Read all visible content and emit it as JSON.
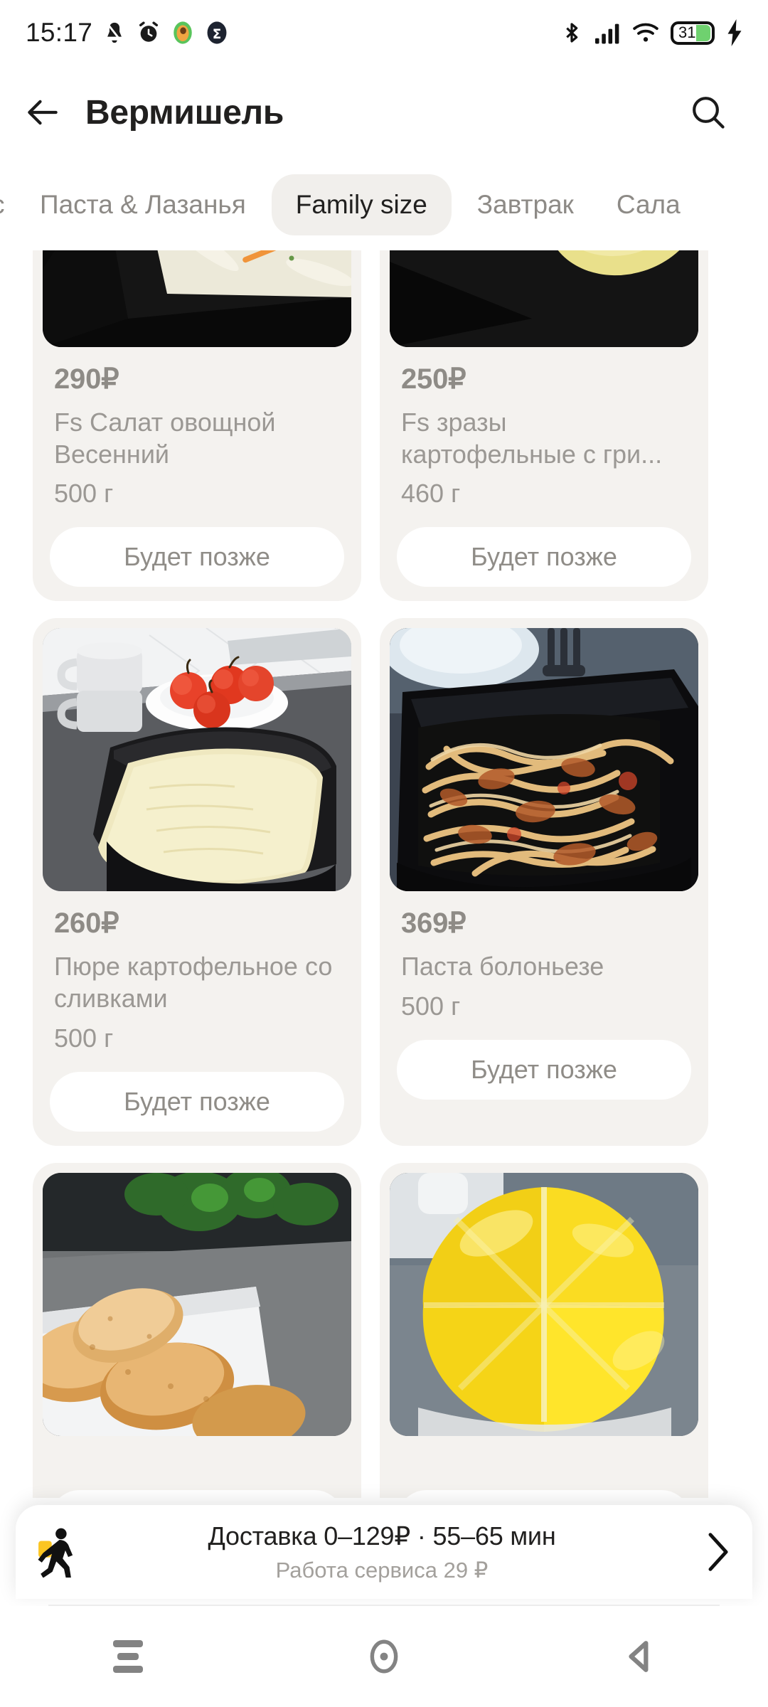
{
  "status_bar": {
    "time": "15:17",
    "left_icons": [
      "notification-silenced-icon",
      "alarm-icon",
      "avocado-app-icon",
      "sigma-app-icon"
    ],
    "right_icons": [
      "bluetooth-icon",
      "cellular-signal-icon",
      "wifi-icon",
      "battery-icon",
      "charging-bolt-icon"
    ],
    "battery_level": "31"
  },
  "header": {
    "title": "Вермишель",
    "back_icon": "back-arrow-icon",
    "search_icon": "search-icon"
  },
  "tabs": {
    "items": [
      {
        "label": "с",
        "active": false,
        "clipped": true
      },
      {
        "label": "Паста & Лазанья",
        "active": false
      },
      {
        "label": "Family size",
        "active": true
      },
      {
        "label": "Завтрак",
        "active": false
      },
      {
        "label": "Салa",
        "active": false,
        "clipped": true
      }
    ]
  },
  "products": [
    {
      "price": "290₽",
      "name": "Fs Салат овощной Весенний",
      "weight": "500 г",
      "button": "Будет позже",
      "image": "vegetable-salad-photo"
    },
    {
      "price": "250₽",
      "name": "Fs зразы картофельные с гри...",
      "weight": "460 г",
      "button": "Будет позже",
      "image": "potato-zrazy-photo"
    },
    {
      "price": "260₽",
      "name": "Пюре картофельное со сливками",
      "weight": "500 г",
      "button": "Будет позже",
      "image": "mashed-potatoes-photo"
    },
    {
      "price": "369₽",
      "name": "Паста болоньезе",
      "weight": "500 г",
      "button": "Будет позже",
      "image": "pasta-bolognese-photo"
    },
    {
      "price": "",
      "name": "",
      "weight": "",
      "button": "",
      "image": "breaded-cutlets-photo"
    },
    {
      "price": "",
      "name": "",
      "weight": "",
      "button": "",
      "image": "yellow-glazed-cake-photo"
    }
  ],
  "delivery_bar": {
    "main": "Доставка 0–129₽ · 55–65 мин",
    "sub": "Работа сервиса 29 ₽",
    "courier_icon": "walking-courier-icon",
    "chevron_icon": "chevron-right-icon"
  },
  "nav_bar": {
    "recents_icon": "recents-icon",
    "home_icon": "home-icon",
    "back_icon": "nav-back-icon"
  },
  "colors": {
    "accent_yellow": "#fcc521",
    "card_bg": "#f4f2ef",
    "muted_text": "#9b9894",
    "battery_fill": "#6fd16f"
  }
}
